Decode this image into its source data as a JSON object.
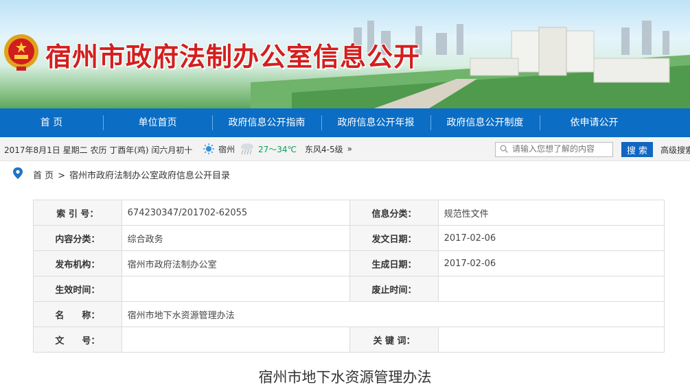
{
  "header": {
    "site_title": "宿州市政府法制办公室信息公开"
  },
  "nav": [
    {
      "label": "首 页"
    },
    {
      "label": "单位首页"
    },
    {
      "label": "政府信息公开指南"
    },
    {
      "label": "政府信息公开年报"
    },
    {
      "label": "政府信息公开制度"
    },
    {
      "label": "依申请公开"
    }
  ],
  "infobar": {
    "date": "2017年8月1日 星期二 农历 丁酉年(鸡) 闰六月初十",
    "city": "宿州",
    "temperature": "27～34℃",
    "wind": "东风4-5级",
    "wind_more": "»",
    "search_placeholder": "请输入您想了解的内容",
    "search_button": "搜 索",
    "advanced": "高级搜索"
  },
  "breadcrumb": {
    "home": "首 页",
    "separator": ">",
    "current": "宿州市政府法制办公室政府信息公开目录"
  },
  "meta": {
    "rows": [
      {
        "l1": "索 引 号：",
        "v1": "674230347/201702-62055",
        "l2": "信息分类：",
        "v2": "规范性文件"
      },
      {
        "l1": "内容分类：",
        "v1": "综合政务",
        "l2": "发文日期：",
        "v2": "2017-02-06"
      },
      {
        "l1": "发布机构：",
        "v1": "宿州市政府法制办公室",
        "l2": "生成日期：",
        "v2": "2017-02-06"
      },
      {
        "l1": "生效时间：",
        "v1": "",
        "l2": "废止时间：",
        "v2": ""
      }
    ],
    "name_label": "名　　称：",
    "name_value": "宿州市地下水资源管理办法",
    "doc_no_label": "文　　号：",
    "doc_no_value": "",
    "keyword_label": "关 键 词：",
    "keyword_value": ""
  },
  "document": {
    "title": "宿州市地下水资源管理办法"
  },
  "colors": {
    "nav_bg": "#0b6dc4",
    "title_red": "#d31f1f",
    "search_button": "#1066c2"
  }
}
